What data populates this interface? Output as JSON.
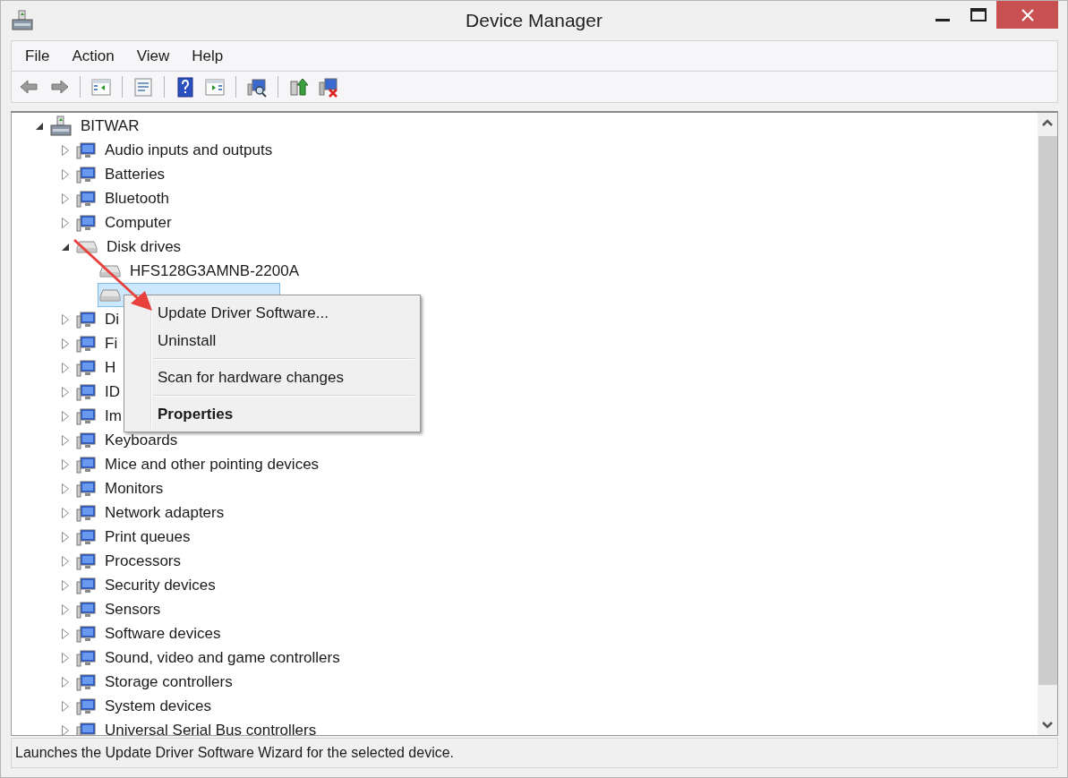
{
  "window": {
    "title": "Device Manager"
  },
  "menu_bar": [
    "File",
    "Action",
    "View",
    "Help"
  ],
  "tree": {
    "label": "BITWAR",
    "expanded": true,
    "children": [
      {
        "label": "Audio inputs and outputs",
        "expanded": false
      },
      {
        "label": "Batteries",
        "expanded": false
      },
      {
        "label": "Bluetooth",
        "expanded": false
      },
      {
        "label": "Computer",
        "expanded": false
      },
      {
        "label": "Disk drives",
        "expanded": true,
        "children": [
          {
            "label": "HFS128G3AMNB-2200A",
            "selected": false
          },
          {
            "selected": true
          }
        ]
      },
      {
        "label": "Di",
        "expanded": false
      },
      {
        "label": "Fi",
        "expanded": false
      },
      {
        "label": "H",
        "expanded": false
      },
      {
        "label": "ID",
        "expanded": false
      },
      {
        "label": "Im",
        "expanded": false
      },
      {
        "label": "Keyboards",
        "expanded": false
      },
      {
        "label": "Mice and other pointing devices",
        "expanded": false
      },
      {
        "label": "Monitors",
        "expanded": false
      },
      {
        "label": "Network adapters",
        "expanded": false
      },
      {
        "label": "Print queues",
        "expanded": false
      },
      {
        "label": "Processors",
        "expanded": false
      },
      {
        "label": "Security devices",
        "expanded": false
      },
      {
        "label": "Sensors",
        "expanded": false
      },
      {
        "label": "Software devices",
        "expanded": false
      },
      {
        "label": "Sound, video and game controllers",
        "expanded": false
      },
      {
        "label": "Storage controllers",
        "expanded": false
      },
      {
        "label": "System devices",
        "expanded": false
      },
      {
        "label": "Universal Serial Bus controllers",
        "expanded": false
      }
    ]
  },
  "context_menu": {
    "items": [
      {
        "kind": "item",
        "label": "Update Driver Software...",
        "default": false
      },
      {
        "kind": "item",
        "label": "Uninstall",
        "default": false
      },
      {
        "kind": "separator"
      },
      {
        "kind": "item",
        "label": "Scan for hardware changes",
        "default": false
      },
      {
        "kind": "separator"
      },
      {
        "kind": "item",
        "label": "Properties",
        "default": true
      }
    ]
  },
  "status_bar": "Launches the Update Driver Software Wizard for the selected device."
}
